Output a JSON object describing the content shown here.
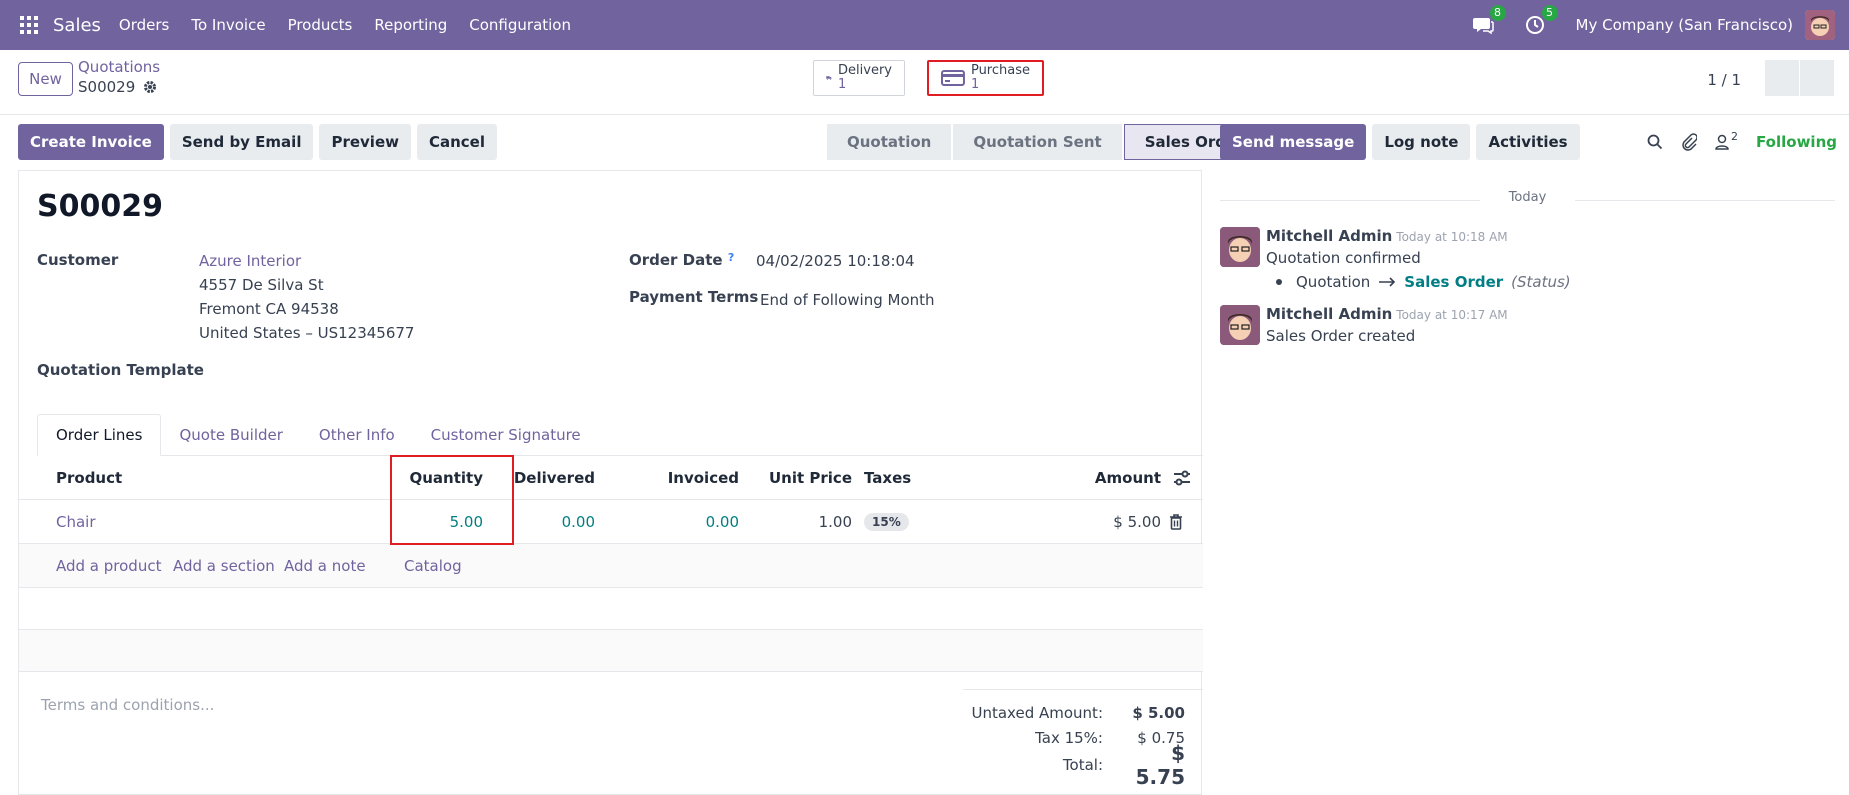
{
  "navbar": {
    "brand": "Sales",
    "menu": [
      "Orders",
      "To Invoice",
      "Products",
      "Reporting",
      "Configuration"
    ],
    "messages_badge": "8",
    "activities_badge": "5",
    "company": "My Company (San Francisco)"
  },
  "control": {
    "new_label": "New",
    "breadcrumb": "Quotations",
    "record": "S00029",
    "smart_buttons": [
      {
        "label": "Delivery",
        "count": "1"
      },
      {
        "label": "Purchase",
        "count": "1"
      }
    ],
    "pager": "1 / 1"
  },
  "actions": {
    "create_invoice": "Create Invoice",
    "send_email": "Send by Email",
    "preview": "Preview",
    "cancel": "Cancel"
  },
  "status": {
    "stages": [
      "Quotation",
      "Quotation Sent",
      "Sales Order"
    ],
    "current": "Sales Order"
  },
  "form": {
    "title": "S00029",
    "customer_label": "Customer",
    "customer_name": "Azure Interior",
    "address1": "4557 De Silva St",
    "address2": "Fremont CA 94538",
    "address3": "United States – US12345677",
    "order_date_label": "Order Date",
    "order_date_help": "?",
    "order_date": "04/02/2025 10:18:04",
    "payment_terms_label": "Payment Terms",
    "payment_terms": "End of Following Month",
    "template_label": "Quotation Template"
  },
  "tabs": [
    "Order Lines",
    "Quote Builder",
    "Other Info",
    "Customer Signature"
  ],
  "table": {
    "headers": {
      "product": "Product",
      "quantity": "Quantity",
      "delivered": "Delivered",
      "invoiced": "Invoiced",
      "unit_price": "Unit Price",
      "taxes": "Taxes",
      "amount": "Amount"
    },
    "rows": [
      {
        "product": "Chair",
        "quantity": "5.00",
        "delivered": "0.00",
        "invoiced": "0.00",
        "unit_price": "1.00",
        "taxes": "15%",
        "amount": "$ 5.00"
      }
    ],
    "add_links": [
      "Add a product",
      "Add a section",
      "Add a note",
      "Catalog"
    ]
  },
  "footer": {
    "terms_placeholder": "Terms and conditions...",
    "untaxed_label": "Untaxed Amount:",
    "untaxed_value": "$ 5.00",
    "tax_label": "Tax 15%:",
    "tax_value": "$ 0.75",
    "total_label": "Total:",
    "total_value": "$ 5.75"
  },
  "chatter": {
    "send_message": "Send message",
    "log_note": "Log note",
    "activities": "Activities",
    "followers_count": "2",
    "following": "Following",
    "today": "Today",
    "messages": [
      {
        "author": "Mitchell Admin",
        "time": "Today at 10:18 AM",
        "body": "Quotation confirmed",
        "change_from": "Quotation",
        "change_to": "Sales Order",
        "change_field": "(Status)"
      },
      {
        "author": "Mitchell Admin",
        "time": "Today at 10:17 AM",
        "body": "Sales Order created"
      }
    ]
  },
  "colors": {
    "brand": "#71639e",
    "highlight": "#e11d24",
    "teal": "#017e84",
    "following": "#28a745"
  }
}
